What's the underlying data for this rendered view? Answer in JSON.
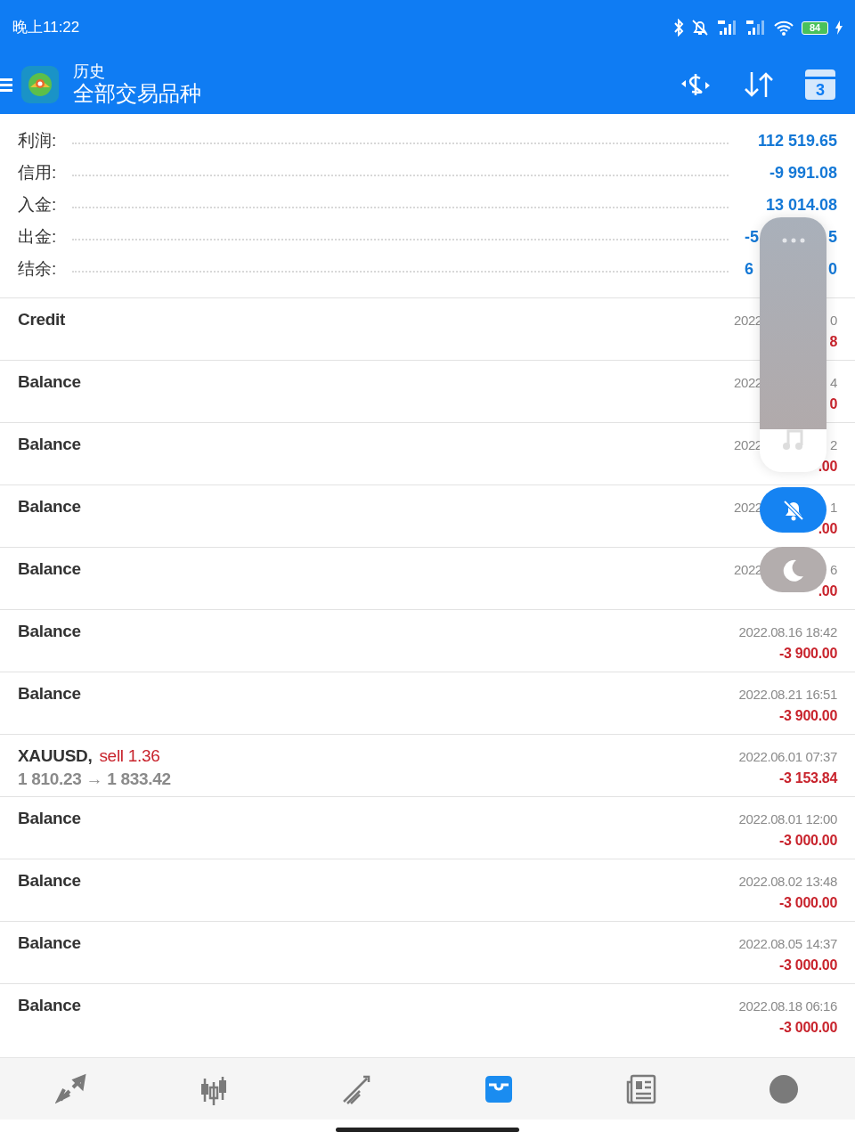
{
  "status_bar": {
    "time": "晚上11:22",
    "battery": "84"
  },
  "toolbar": {
    "subtitle": "历史",
    "title": "全部交易品种",
    "calendar_day": "3"
  },
  "summary": [
    {
      "label": "利润:",
      "value": "112 519.65"
    },
    {
      "label": "信用:",
      "value": "-9 991.08"
    },
    {
      "label": "入金:",
      "value": "13 014.08"
    },
    {
      "label": "出金:",
      "value_start": "-5",
      "value_end": "5"
    },
    {
      "label": "结余:",
      "value_start": "6",
      "value_end": "0"
    }
  ],
  "deals": [
    {
      "title": "Credit",
      "date_start": "2022",
      "date_end": "0",
      "amount": "8"
    },
    {
      "title": "Balance",
      "date_start": "2022",
      "date_end": "4",
      "amount": "0"
    },
    {
      "title": "Balance",
      "date_start": "2022",
      "date_end": "2",
      "amount": ".00"
    },
    {
      "title": "Balance",
      "date_start": "2022",
      "date_end": "1",
      "amount": ".00"
    },
    {
      "title": "Balance",
      "date_start": "2022",
      "date_end": "6",
      "amount": ".00"
    },
    {
      "title": "Balance",
      "date": "2022.08.16 18:42",
      "amount": "-3 900.00"
    },
    {
      "title": "Balance",
      "date": "2022.08.21 16:51",
      "amount": "-3 900.00"
    },
    {
      "title": "XAUUSD,",
      "side": "sell 1.36",
      "prices": "1 810.23 → 1 833.42",
      "date": "2022.06.01 07:37",
      "amount": "-3 153.84"
    },
    {
      "title": "Balance",
      "date": "2022.08.01 12:00",
      "amount": "-3 000.00"
    },
    {
      "title": "Balance",
      "date": "2022.08.02 13:48",
      "amount": "-3 000.00"
    },
    {
      "title": "Balance",
      "date": "2022.08.05 14:37",
      "amount": "-3 000.00"
    },
    {
      "title": "Balance",
      "date": "2022.08.18 06:16",
      "amount": "-3 000.00"
    }
  ],
  "bottom_nav": [
    {
      "kind": "trade",
      "selected": false
    },
    {
      "kind": "quotes",
      "selected": false
    },
    {
      "kind": "chart",
      "selected": false
    },
    {
      "kind": "history",
      "selected": true
    },
    {
      "kind": "news",
      "selected": false
    },
    {
      "kind": "account",
      "selected": false
    }
  ]
}
